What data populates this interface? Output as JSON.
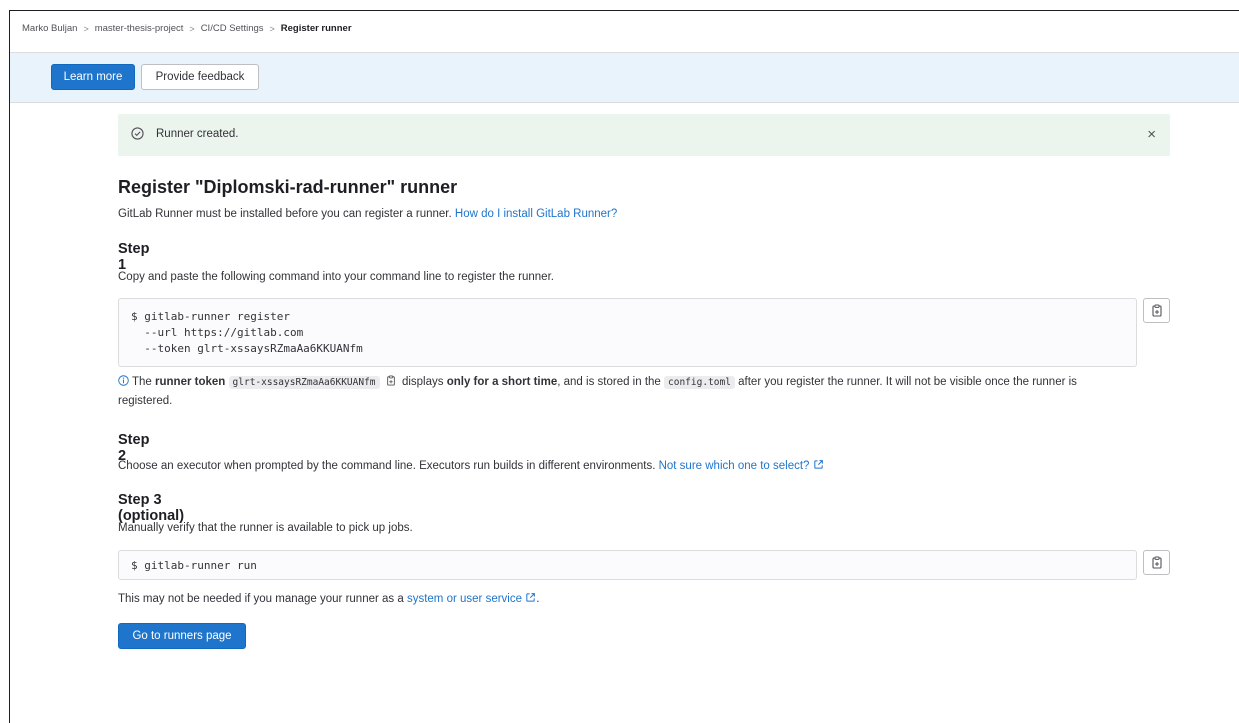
{
  "breadcrumb": {
    "items": [
      "Marko Buljan",
      "master-thesis-project",
      "CI/CD Settings"
    ],
    "current": "Register runner"
  },
  "banner": {
    "learn_more": "Learn more",
    "feedback": "Provide feedback"
  },
  "alert": {
    "message": "Runner created.",
    "close": "×"
  },
  "page": {
    "title": "Register \"Diplomski-rad-runner\" runner",
    "intro": "GitLab Runner must be installed before you can register a runner.",
    "intro_link": "How do I install GitLab Runner?"
  },
  "step1": {
    "title": "Step 1",
    "desc": "Copy and paste the following command into your command line to register the runner.",
    "code": [
      "$ gitlab-runner register",
      "  --url https://gitlab.com",
      "  --token glrt-xssaysRZmaAa6KKUANfm"
    ],
    "note_prefix": "The",
    "note_bold1": "runner token",
    "token": "glrt-xssaysRZmaAa6KKUANfm",
    "note_mid": "displays",
    "note_bold2": "only for a short time",
    "note_mid2": ", and is stored in the",
    "config": "config.toml",
    "note_end": "after you register the runner. It will not be visible once the runner is",
    "note_end2": "registered."
  },
  "step2": {
    "title": "Step 2",
    "desc": "Choose an executor when prompted by the command line. Executors run builds in different environments.",
    "link": "Not sure which one to select?"
  },
  "step3": {
    "title": "Step 3 (optional)",
    "desc": "Manually verify that the runner is available to pick up jobs.",
    "code": "$ gitlab-runner run",
    "footer": "This may not be needed if you manage your runner as a",
    "footer_link": "system or user service",
    "footer_end": "."
  },
  "go_button": "Go to runners page",
  "colors": {
    "primary": "#1f75cb",
    "success_bg": "#ecf4ee",
    "banner_bg": "#e9f3fc"
  }
}
